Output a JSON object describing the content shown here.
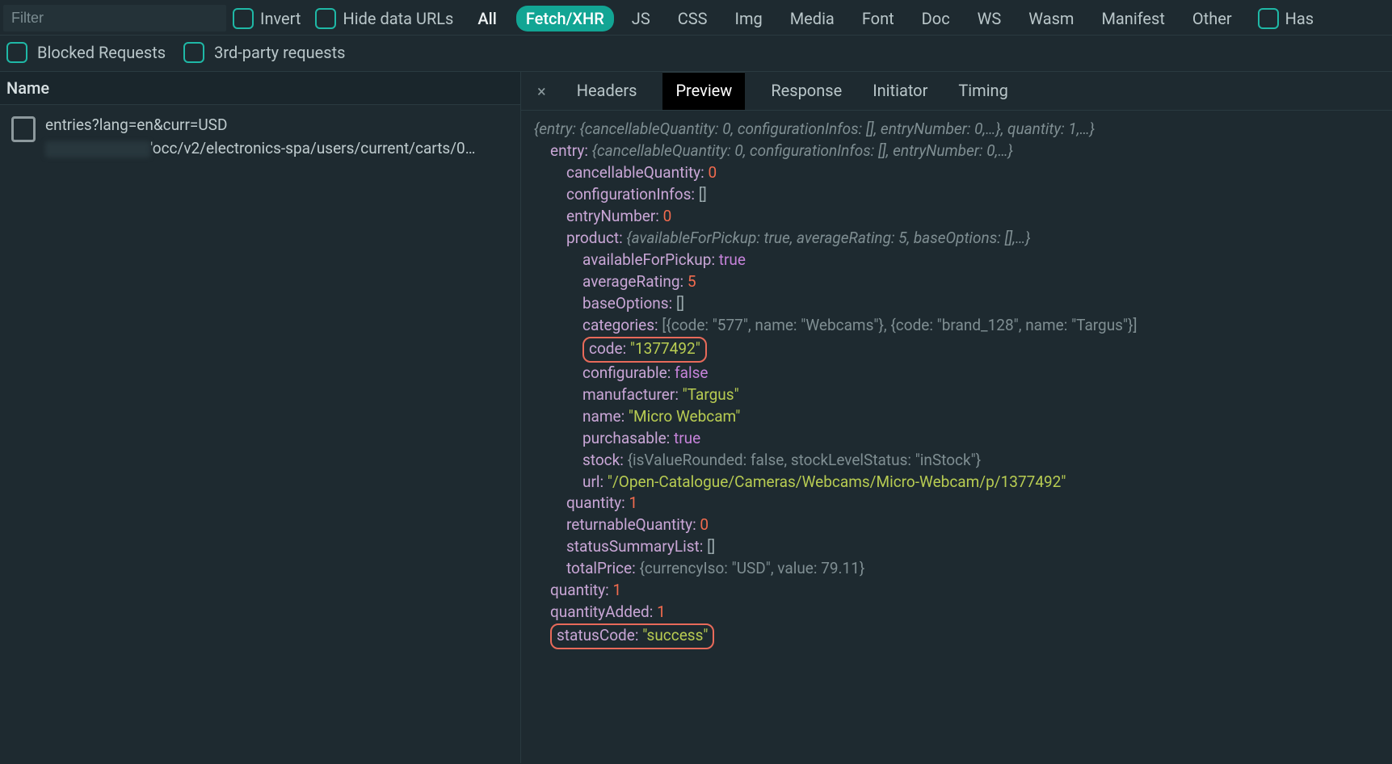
{
  "filter": {
    "placeholder": "Filter"
  },
  "toolbar": {
    "invert": "Invert",
    "hideDataUrls": "Hide data URLs",
    "types": [
      "All",
      "Fetch/XHR",
      "JS",
      "CSS",
      "Img",
      "Media",
      "Font",
      "Doc",
      "WS",
      "Wasm",
      "Manifest",
      "Other"
    ],
    "activeType": "Fetch/XHR",
    "hasLabel": "Has",
    "blocked": "Blocked Requests",
    "thirdParty": "3rd-party requests"
  },
  "columns": {
    "name": "Name"
  },
  "request": {
    "line1": "entries?lang=en&curr=USD",
    "line2suffix": "'occ/v2/electronics-spa/users/current/carts/0…"
  },
  "tabs": {
    "close": "×",
    "items": [
      "Headers",
      "Preview",
      "Response",
      "Initiator",
      "Timing"
    ],
    "active": "Preview"
  },
  "preview": {
    "rootSummary": "{entry: {cancellableQuantity: 0, configurationInfos: [], entryNumber: 0,…}, quantity: 1,…}",
    "entryKey": "entry",
    "entrySummary": "{cancellableQuantity: 0, configurationInfos: [], entryNumber: 0,…}",
    "cancellableQuantity": {
      "k": "cancellableQuantity",
      "v": "0"
    },
    "configurationInfos": {
      "k": "configurationInfos",
      "v": "[]"
    },
    "entryNumber": {
      "k": "entryNumber",
      "v": "0"
    },
    "productKey": "product",
    "productSummary": "{availableForPickup: true, averageRating: 5, baseOptions: [],…}",
    "availableForPickup": {
      "k": "availableForPickup",
      "v": "true"
    },
    "averageRating": {
      "k": "averageRating",
      "v": "5"
    },
    "baseOptions": {
      "k": "baseOptions",
      "v": "[]"
    },
    "categoriesKey": "categories",
    "categoriesSummary": "[{code: \"577\", name: \"Webcams\"}, {code: \"brand_128\", name: \"Targus\"}]",
    "code": {
      "k": "code",
      "v": "\"1377492\""
    },
    "configurable": {
      "k": "configurable",
      "v": "false"
    },
    "manufacturer": {
      "k": "manufacturer",
      "v": "\"Targus\""
    },
    "name": {
      "k": "name",
      "v": "\"Micro Webcam\""
    },
    "purchasable": {
      "k": "purchasable",
      "v": "true"
    },
    "stockKey": "stock",
    "stockSummary": "{isValueRounded: false, stockLevelStatus: \"inStock\"}",
    "url": {
      "k": "url",
      "v": "\"/Open-Catalogue/Cameras/Webcams/Micro-Webcam/p/1377492\""
    },
    "quantity": {
      "k": "quantity",
      "v": "1"
    },
    "returnableQuantity": {
      "k": "returnableQuantity",
      "v": "0"
    },
    "statusSummaryList": {
      "k": "statusSummaryList",
      "v": "[]"
    },
    "totalPriceKey": "totalPrice",
    "totalPriceSummary": "{currencyIso: \"USD\", value: 79.11}",
    "topQuantity": {
      "k": "quantity",
      "v": "1"
    },
    "quantityAdded": {
      "k": "quantityAdded",
      "v": "1"
    },
    "statusCode": {
      "k": "statusCode",
      "v": "\"success\""
    }
  }
}
